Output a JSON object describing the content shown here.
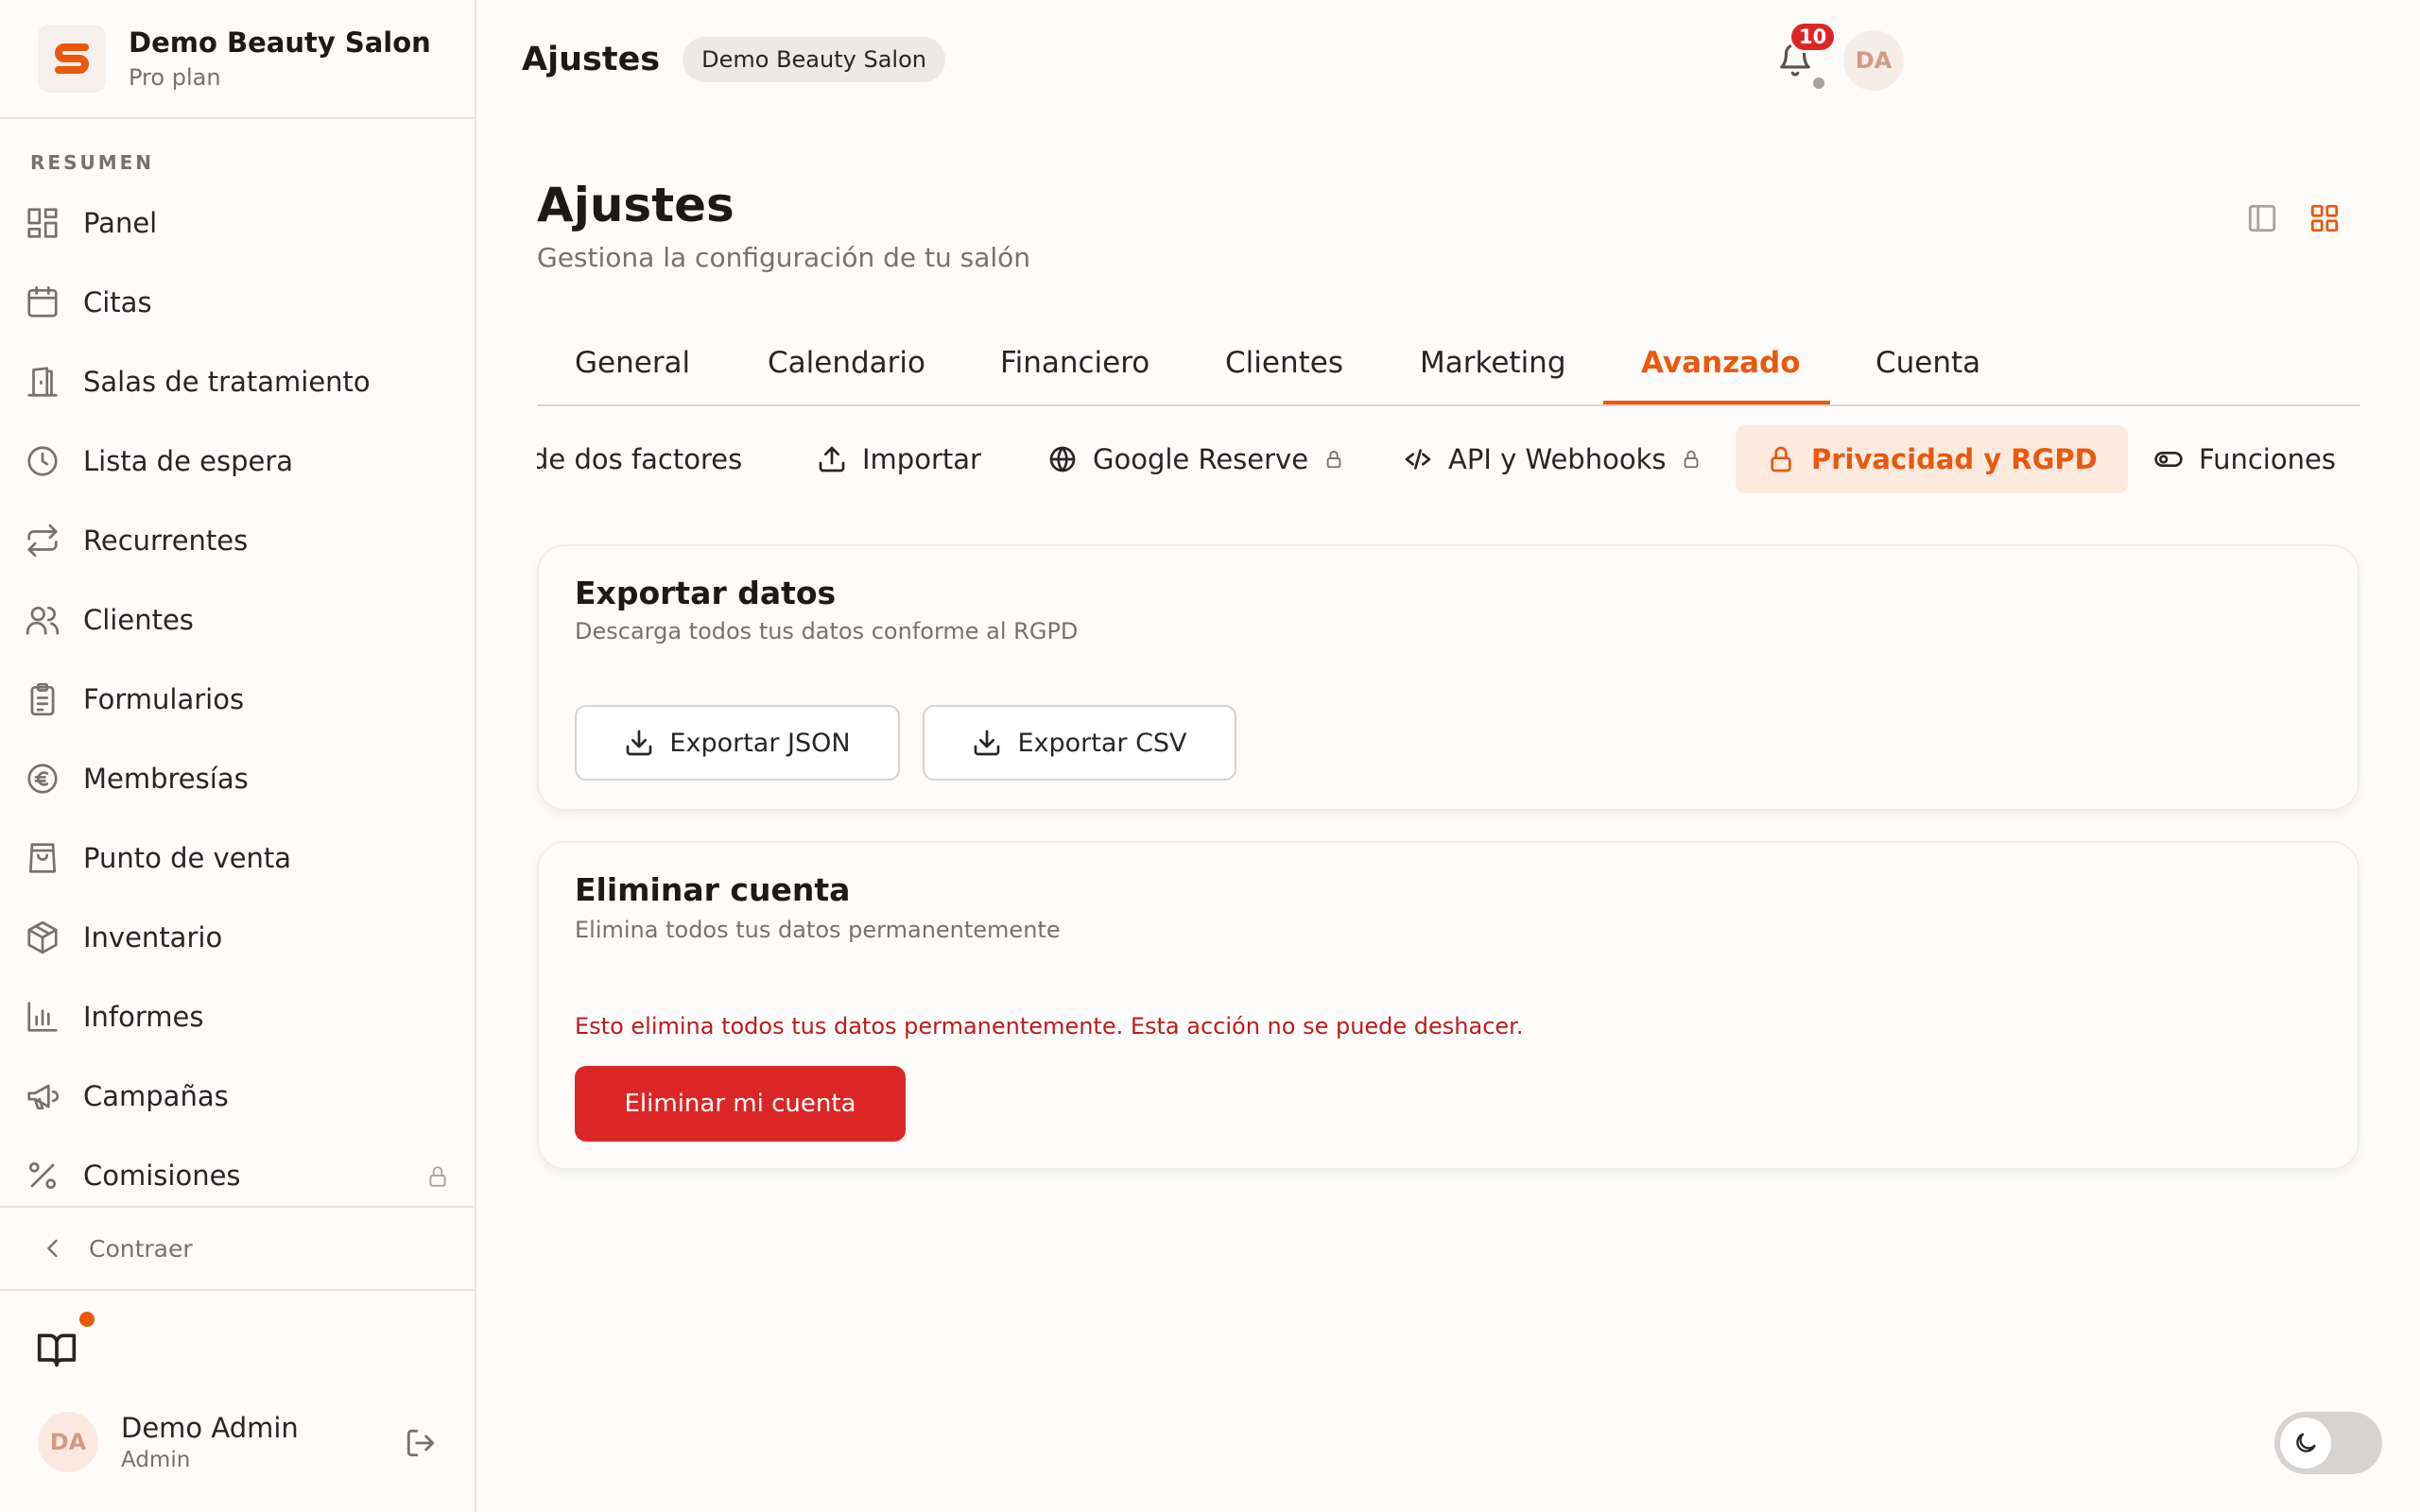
{
  "brand": {
    "name": "Demo Beauty Salon",
    "plan": "Pro plan",
    "logo_letter": "S",
    "accent": "#ea580c"
  },
  "sidebar": {
    "section_label": "RESUMEN",
    "items": [
      {
        "label": "Panel",
        "icon": "grid-icon"
      },
      {
        "label": "Citas",
        "icon": "calendar-icon"
      },
      {
        "label": "Salas de tratamiento",
        "icon": "door-icon"
      },
      {
        "label": "Lista de espera",
        "icon": "clock-icon"
      },
      {
        "label": "Recurrentes",
        "icon": "repeat-icon"
      },
      {
        "label": "Clientes",
        "icon": "users-icon"
      },
      {
        "label": "Formularios",
        "icon": "clipboard-icon"
      },
      {
        "label": "Membresías",
        "icon": "euro-icon"
      },
      {
        "label": "Punto de venta",
        "icon": "shopping-bag-icon"
      },
      {
        "label": "Inventario",
        "icon": "package-icon"
      },
      {
        "label": "Informes",
        "icon": "bar-chart-icon"
      },
      {
        "label": "Campañas",
        "icon": "megaphone-icon"
      },
      {
        "label": "Comisiones",
        "icon": "percent-icon",
        "locked": true
      }
    ],
    "collapse_label": "Contraer"
  },
  "user": {
    "initials": "DA",
    "name": "Demo Admin",
    "role": "Admin"
  },
  "header": {
    "title": "Ajustes",
    "chip": "Demo Beauty Salon",
    "notifications": "10",
    "avatar_initials": "DA"
  },
  "page": {
    "title": "Ajustes",
    "subtitle": "Gestiona la configuración de tu salón"
  },
  "tabs": [
    "General",
    "Calendario",
    "Financiero",
    "Clientes",
    "Marketing",
    "Avanzado",
    "Cuenta"
  ],
  "active_tab": "Avanzado",
  "subtabs": [
    {
      "label": "de dos factores",
      "icon": ""
    },
    {
      "label": "Importar",
      "icon": "upload-icon"
    },
    {
      "label": "Google Reserve",
      "icon": "globe-icon",
      "locked": true
    },
    {
      "label": "API y Webhooks",
      "icon": "code-icon",
      "locked": true
    },
    {
      "label": "Privacidad y RGPD",
      "icon": "lock-icon",
      "active": true
    },
    {
      "label": "Funciones",
      "icon": "toggle-icon"
    }
  ],
  "export_card": {
    "title": "Exportar datos",
    "subtitle": "Descarga todos tus datos conforme al RGPD",
    "json_button": "Exportar JSON",
    "csv_button": "Exportar CSV"
  },
  "delete_card": {
    "title": "Eliminar cuenta",
    "subtitle": "Elimina todos tus datos permanentemente",
    "warning": "Esto elimina todos tus datos permanentemente. Esta acción no se puede deshacer.",
    "button": "Eliminar mi cuenta"
  },
  "colors": {
    "accent": "#ea580c",
    "danger": "#dc2626",
    "danger_text": "#b91c1c"
  }
}
